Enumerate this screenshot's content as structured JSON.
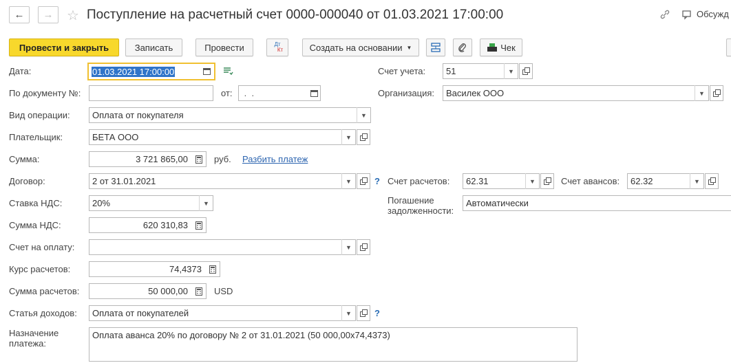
{
  "window": {
    "title": "Поступление на расчетный счет 0000-000040 от 01.03.2021 17:00:00",
    "discuss_label": "Обсужд"
  },
  "toolbar": {
    "post_close": "Провести и закрыть",
    "save": "Записать",
    "post": "Провести",
    "dtkt_top": "Дт",
    "dtkt_bottom": "Кт",
    "create_based": "Создать на основании",
    "receipt": "Чек"
  },
  "form": {
    "date": {
      "label": "Дата:",
      "value": "01.03.2021 17:00:00"
    },
    "account": {
      "label": "Счет учета:",
      "value": "51"
    },
    "doc_number": {
      "label": "По документу №:",
      "value": "",
      "from_label": "от:",
      "from_value": " .  ."
    },
    "organization": {
      "label": "Организация:",
      "value": "Василек ООО"
    },
    "operation": {
      "label": "Вид операции:",
      "value": "Оплата от покупателя"
    },
    "payer": {
      "label": "Плательщик:",
      "value": "БЕТА ООО"
    },
    "amount": {
      "label": "Сумма:",
      "value": "3 721 865,00",
      "currency": "руб.",
      "split_link": "Разбить платеж"
    },
    "contract": {
      "label": "Договор:",
      "value": "2 от 31.01.2021",
      "help": "?"
    },
    "settle_account": {
      "label": "Счет расчетов:",
      "value": "62.31"
    },
    "advance_account": {
      "label": "Счет авансов:",
      "value": "62.32"
    },
    "vat_rate": {
      "label": "Ставка НДС:",
      "value": "20%"
    },
    "debt_repayment": {
      "label_line1": "Погашение",
      "label_line2": "задолженности:",
      "value": "Автоматически"
    },
    "vat_amount": {
      "label": "Сумма НДС:",
      "value": "620 310,83"
    },
    "invoice": {
      "label": "Счет на оплату:",
      "value": ""
    },
    "rate": {
      "label": "Курс расчетов:",
      "value": "74,4373"
    },
    "settle_amount": {
      "label": "Сумма расчетов:",
      "value": "50 000,00",
      "currency": "USD"
    },
    "income_item": {
      "label": "Статья доходов:",
      "value": "Оплата от покупателей",
      "help": "?"
    },
    "purpose": {
      "label_line1": "Назначение",
      "label_line2": "платежа:",
      "value": "Оплата аванса 20% по договору № 2 от 31.01.2021 (50 000,00x74,4373)"
    }
  },
  "colors": {
    "primary_button": "#f8d82c",
    "link": "#2d65b0",
    "focus_border": "#f0c030"
  }
}
